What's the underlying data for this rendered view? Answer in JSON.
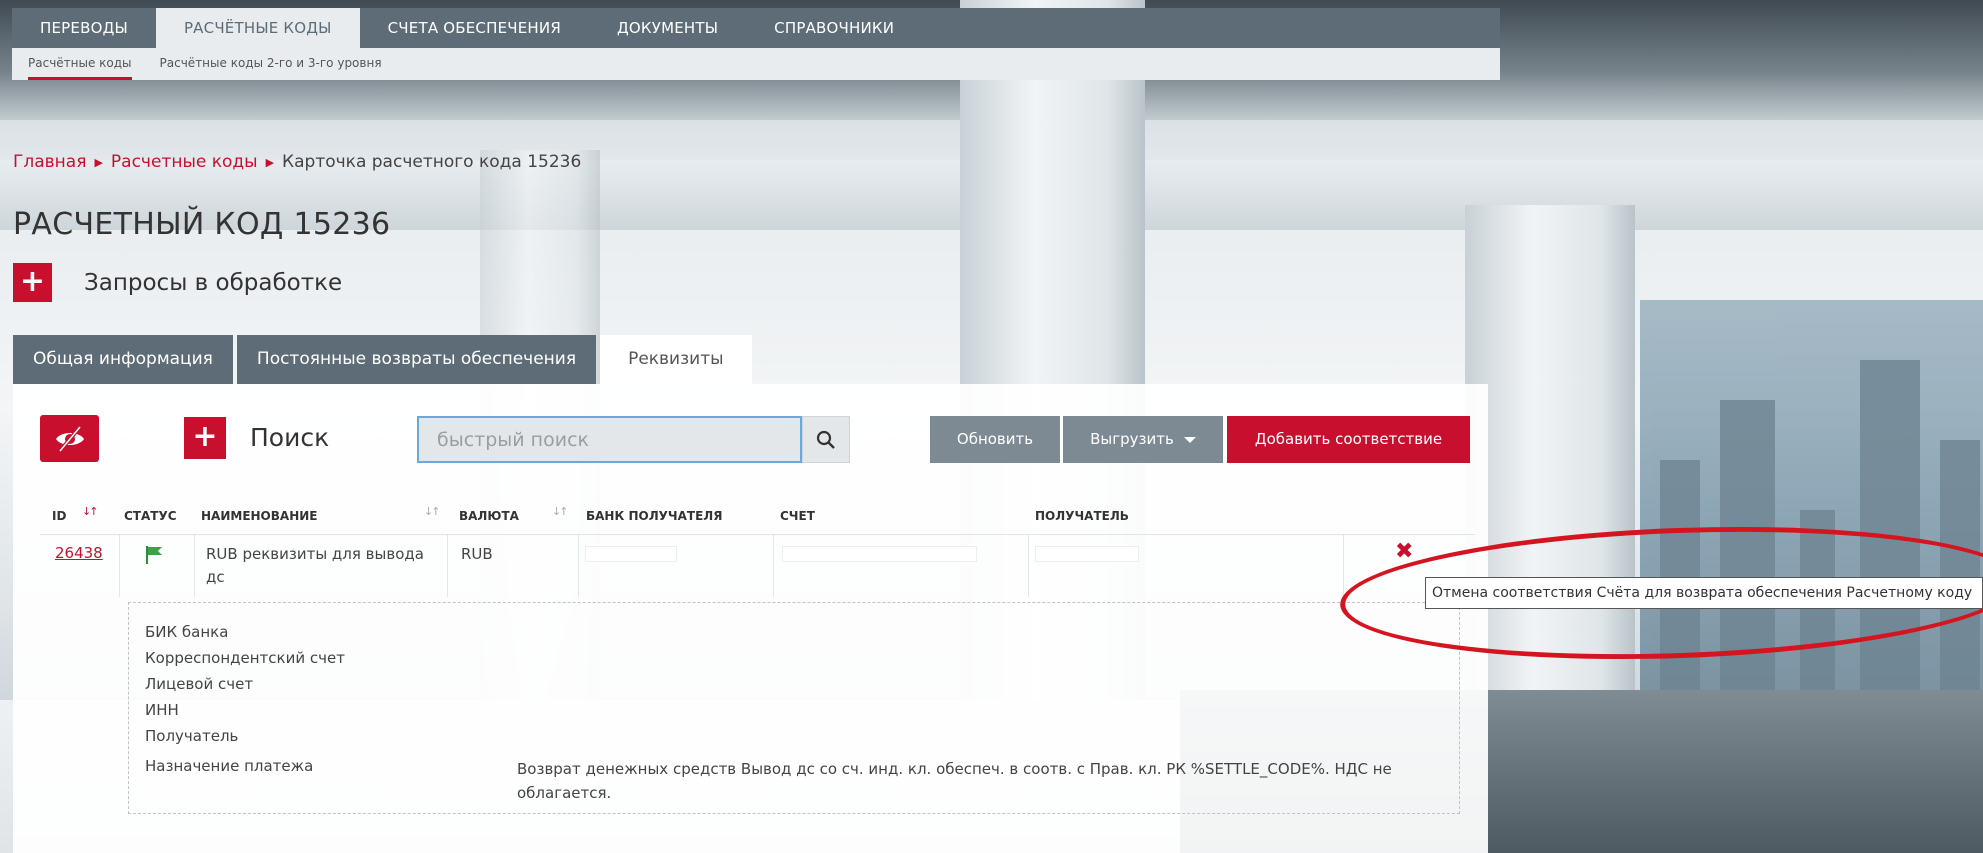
{
  "colors": {
    "accent": "#c8102e",
    "nav": "#5d6c76",
    "button_gray": "#7d8a93",
    "link": "#c8102e"
  },
  "mainnav": {
    "items": [
      {
        "label": "ПЕРЕВОДЫ"
      },
      {
        "label": "РАСЧЁТНЫЕ КОДЫ",
        "active": true
      },
      {
        "label": "СЧЕТА ОБЕСПЕЧЕНИЯ"
      },
      {
        "label": "ДОКУМЕНТЫ"
      },
      {
        "label": "СПРАВОЧНИКИ"
      }
    ]
  },
  "subnav": {
    "items": [
      {
        "label": "Расчётные коды",
        "active": true
      },
      {
        "label": "Расчётные коды 2-го и 3-го уровня"
      }
    ]
  },
  "breadcrumb": {
    "home": "Главная",
    "codes": "Расчетные коды",
    "current": "Карточка расчетного кода 15236",
    "sep_icon": "triangle-right-icon"
  },
  "page": {
    "title": "РАСЧЕТНЫЙ КОД 15236",
    "requests_label": "Запросы в обработке"
  },
  "tabs": [
    {
      "label": "Общая информация"
    },
    {
      "label": "Постоянные возвраты обеспечения"
    },
    {
      "label": "Реквизиты",
      "active": true
    }
  ],
  "toolbar": {
    "search_label": "Поиск",
    "search_placeholder": "быстрый поиск",
    "refresh": "Обновить",
    "export": "Выгрузить",
    "add": "Добавить соответствие"
  },
  "table": {
    "columns": {
      "id": "ID",
      "status": "СТАТУС",
      "name": "НАИМЕНОВАНИЕ",
      "currency": "ВАЛЮТА",
      "bank": "БАНК ПОЛУЧАТЕЛЯ",
      "account": "СЧЕТ",
      "recipient": "ПОЛУЧАТЕЛЬ"
    },
    "rows": [
      {
        "id": "26438",
        "status_icon": "flag-icon",
        "name_line1": "RUB реквизиты для вывода",
        "name_line2": "дс",
        "currency": "RUB"
      }
    ]
  },
  "details": {
    "bik": "БИК банка",
    "corr": "Корреспондентский счет",
    "personal": "Лицевой счет",
    "inn": "ИНН",
    "recipient": "Получатель",
    "purpose": "Назначение платежа",
    "purpose_value_line1": "Возврат денежных средств Вывод дс со сч. инд. кл. обеспеч. в соотв. с Прав. кл. РК %SETTLE_CODE%. НДС не",
    "purpose_value_line2": "облагается."
  },
  "tooltip": {
    "text": "Отмена соответствия Счёта для возврата обеспечения Расчетному коду"
  }
}
